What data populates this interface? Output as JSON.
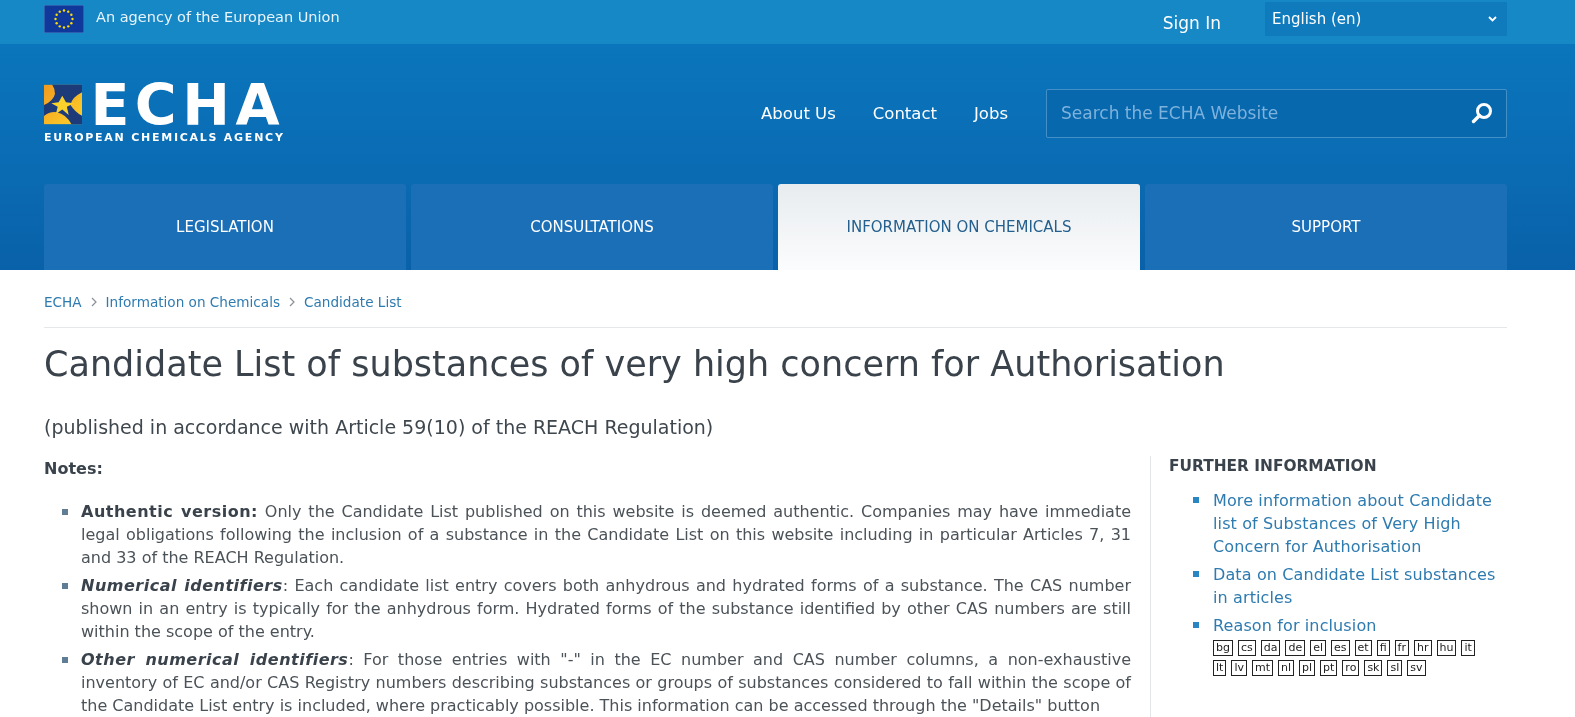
{
  "top_bar": {
    "agency": "An agency of the European Union",
    "sign_in": "Sign In",
    "language": "English (en)"
  },
  "header": {
    "logo": {
      "wordmark": "ECHA",
      "tagline": "EUROPEAN CHEMICALS AGENCY"
    },
    "nav_links": [
      "About Us",
      "Contact",
      "Jobs"
    ],
    "search": {
      "placeholder": "Search the ECHA Website"
    }
  },
  "tabs": [
    {
      "label": "LEGISLATION",
      "selected": false
    },
    {
      "label": "CONSULTATIONS",
      "selected": false
    },
    {
      "label": "INFORMATION ON CHEMICALS",
      "selected": true
    },
    {
      "label": "SUPPORT",
      "selected": false
    }
  ],
  "breadcrumb": [
    "ECHA",
    "Information on Chemicals",
    "Candidate List"
  ],
  "title": "Candidate List of substances of very high concern for Authorisation",
  "subtitle": "(published in accordance with Article 59(10) of the REACH Regulation)",
  "notes": {
    "heading": "Notes:",
    "items": [
      {
        "kind": "notice",
        "term": "Authentic version:",
        "text": " Only the Candidate List published on this website is deemed authentic. Companies may have immediate legal obligations following the inclusion of a substance in the Candidate List on this website including in particular Articles 7, 31 and 33 of the REACH Regulation."
      },
      {
        "kind": "identifier",
        "term": "Numerical identifiers",
        "text": ": Each candidate list entry covers both anhydrous and hydrated forms of a substance. The CAS number shown in an entry is typically for the anhydrous form. Hydrated forms of the substance identified by other CAS numbers are still within the scope of the entry."
      },
      {
        "kind": "identifier",
        "term": "Other numerical identifiers",
        "text": ": For those entries with \"-\" in the EC number and CAS number columns, a non-exhaustive inventory of EC and/or CAS Registry numbers describing substances or groups of substances considered to fall within the scope of the Candidate List entry is included, where practicably possible. This information can be accessed through the \"Details\" button"
      }
    ]
  },
  "further_information": {
    "heading": "FURTHER INFORMATION",
    "links": [
      {
        "text": "More information about Candidate list of Substances of Very High Concern for Authorisation"
      },
      {
        "text": "Data on Candidate List substances in articles"
      },
      {
        "text": "Reason for inclusion",
        "languages": [
          "bg",
          "cs",
          "da",
          "de",
          "el",
          "es",
          "et",
          "fi",
          "fr",
          "hr",
          "hu",
          "it",
          "lt",
          "lv",
          "mt",
          "nl",
          "pl",
          "pt",
          "ro",
          "sk",
          "sl",
          "sv"
        ]
      }
    ]
  }
}
